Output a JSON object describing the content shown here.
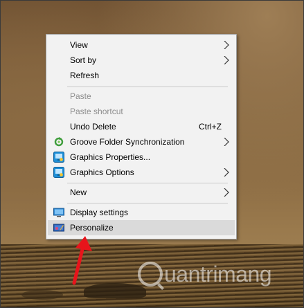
{
  "context_menu": {
    "items": [
      {
        "label": "View",
        "submenu": true
      },
      {
        "label": "Sort by",
        "submenu": true
      },
      {
        "label": "Refresh"
      },
      {
        "label": "Paste",
        "disabled": true
      },
      {
        "label": "Paste shortcut",
        "disabled": true
      },
      {
        "label": "Undo Delete",
        "shortcut": "Ctrl+Z"
      },
      {
        "label": "Groove Folder Synchronization",
        "icon": "groove-sync-icon",
        "submenu": true
      },
      {
        "label": "Graphics Properties...",
        "icon": "intel-graphics-icon"
      },
      {
        "label": "Graphics Options",
        "icon": "intel-graphics-icon",
        "submenu": true
      },
      {
        "label": "New",
        "submenu": true
      },
      {
        "label": "Display settings",
        "icon": "display-icon"
      },
      {
        "label": "Personalize",
        "icon": "personalize-icon",
        "highlighted": true
      }
    ]
  },
  "annotation": {
    "arrow_color": "#e8141b"
  },
  "watermark": {
    "text": "uantrimang"
  },
  "colors": {
    "menu_bg": "#f2f2f2",
    "highlight": "#dadada",
    "disabled_text": "#8e8e8e"
  }
}
